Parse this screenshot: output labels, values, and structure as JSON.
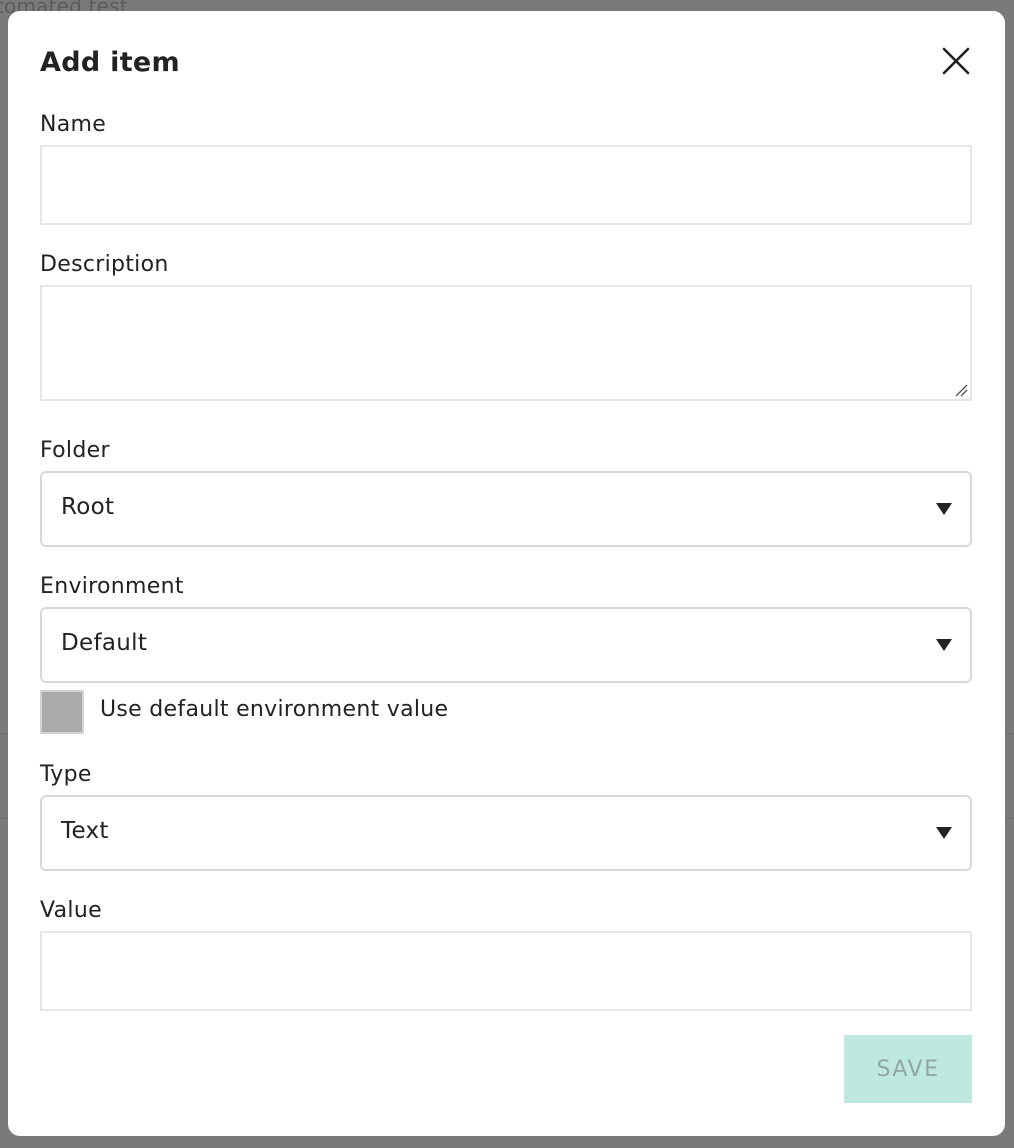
{
  "background": {
    "partial_text": "tomated test"
  },
  "modal": {
    "title": "Add item",
    "close_icon": "close-icon",
    "fields": {
      "name": {
        "label": "Name",
        "value": ""
      },
      "description": {
        "label": "Description",
        "value": ""
      },
      "folder": {
        "label": "Folder",
        "selected": "Root"
      },
      "environment": {
        "label": "Environment",
        "selected": "Default"
      },
      "use_default": {
        "label": "Use default environment value",
        "checked": false
      },
      "type": {
        "label": "Type",
        "selected": "Text"
      },
      "value": {
        "label": "Value",
        "value": ""
      }
    },
    "save_label": "SAVE"
  },
  "colors": {
    "overlay": "#7a7a7a",
    "save_bg": "#bfe8de",
    "save_text": "#8fa9a2",
    "checkbox_fill": "#ababab"
  }
}
